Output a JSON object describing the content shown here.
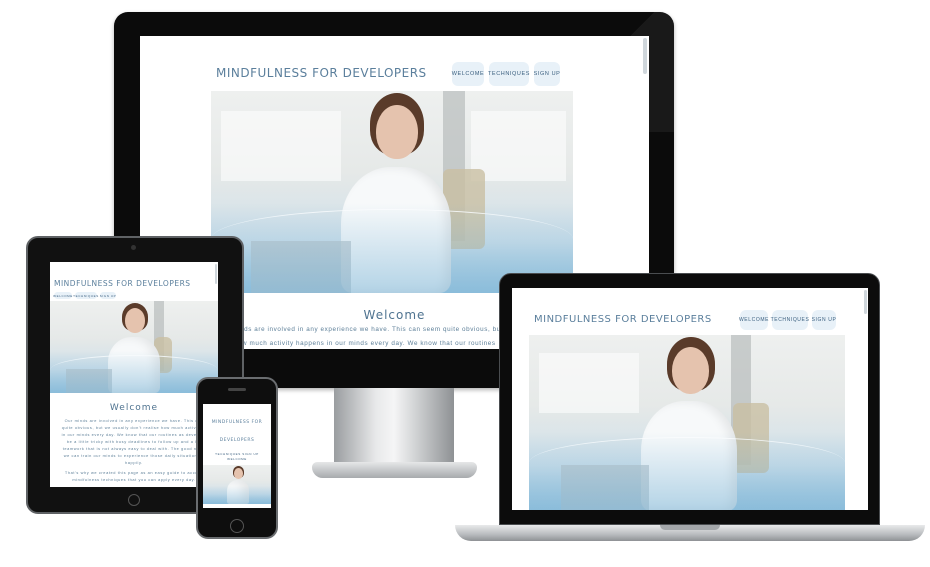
{
  "site": {
    "title": "MINDFULNESS FOR DEVELOPERS",
    "nav": [
      "WELCOME",
      "TECHNIQUES",
      "SIGN UP"
    ],
    "welcome_heading": "Welcome"
  },
  "desktop": {
    "body_lines": [
      "nds are involved in any experience we have. This can seem quite obvious, bu",
      "w much activity happens in our minds every day. We know that our routines"
    ]
  },
  "tablet": {
    "body_lines": [
      "Our minds are involved in any experience we have. This can",
      "quite obvious, but we usually don't realise how much activity h",
      "in our minds every day. We know that our routines as develope",
      "be a little tricky with busy deadlines to follow up and a lot",
      "teamwork that is not always easy to deal with. The good news",
      "we can train our minds to experience those daily situations b",
      "happily.",
      "That's why we created this page as an easy guide to access",
      "mindfulness techniques that you can apply every day."
    ]
  },
  "phone": {
    "title_lines": [
      "MINDFULNESS FOR",
      "DEVELOPERS"
    ],
    "nav_lines": [
      "TECHNIQUES SIGN UP",
      "WELCOME"
    ]
  },
  "colors": {
    "accent": "#5b7f9c",
    "nav_bg": "#e8f1f8",
    "bezel": "#0d0d0d",
    "silver": "#c9ccce"
  }
}
